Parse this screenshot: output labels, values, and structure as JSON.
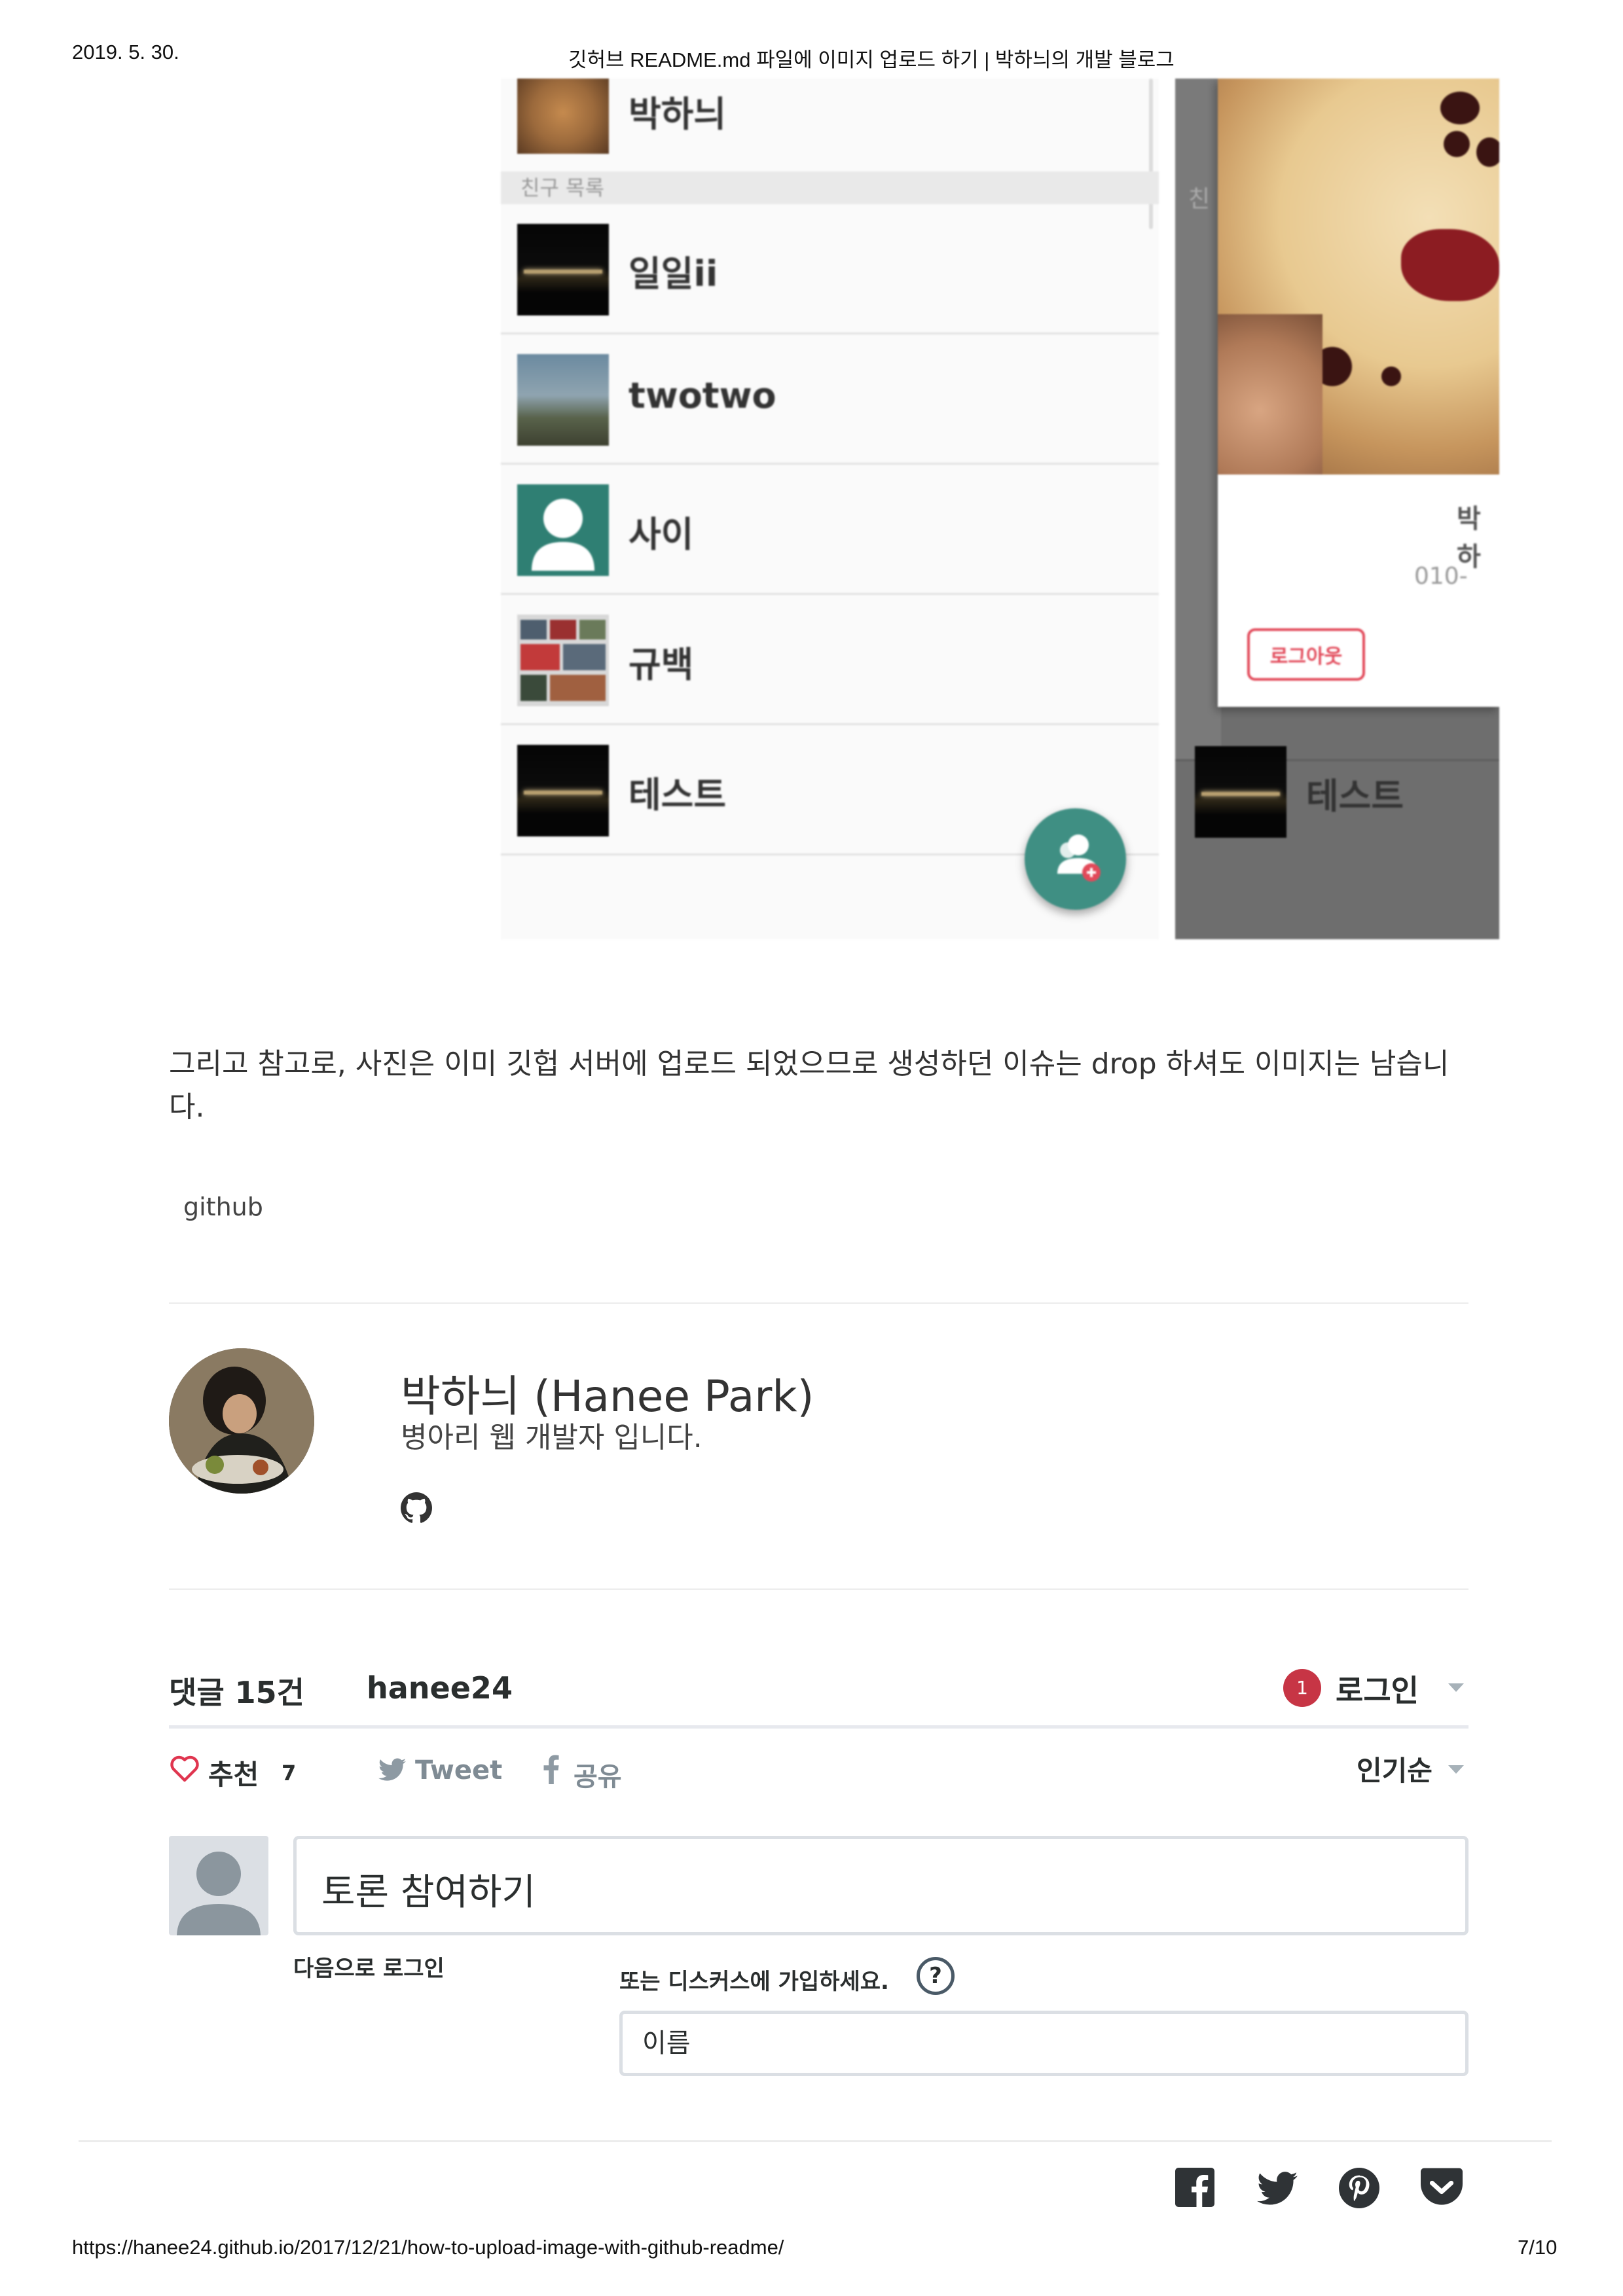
{
  "print_header": {
    "date": "2019. 5. 30.",
    "title": "깃허브 README.md 파일에 이미지 업로드 하기 | 박하늬의 개발 블로그"
  },
  "screenshot": {
    "my_name": "박하늬",
    "section_label": "친구 목록",
    "friends": [
      {
        "name": "일일ii",
        "thumb": "night-bridge"
      },
      {
        "name": "twotwo",
        "thumb": "landscape"
      },
      {
        "name": "사이",
        "thumb": "default-person-icon"
      },
      {
        "name": "규백",
        "thumb": "collage"
      },
      {
        "name": "테스트",
        "thumb": "night-bridge"
      }
    ],
    "right_section_label_partial": "친",
    "right_last_friend": "테스트",
    "profile_card": {
      "name_partial": "박하",
      "phone_partial": "010-",
      "logout_label": "로그아웃"
    },
    "fab_icon": "add-friend-icon"
  },
  "article": {
    "paragraph": "그리고 참고로, 사진은 이미 깃헙 서버에 업로드 되었으므로 생성하던 이슈는 drop 하셔도 이미지는 남습니다.",
    "tag": "github"
  },
  "author": {
    "name": "박하늬 (Hanee Park)",
    "description": "병아리 웹 개발자 입니다.",
    "social_icon": "github-icon"
  },
  "disqus": {
    "comment_count": "댓글 15건",
    "site": "hanee24",
    "notification_count": "1",
    "login_label": "로그인",
    "recommend_label": "추천",
    "recommend_count": "7",
    "tweet_label": "Tweet",
    "share_label": "공유",
    "sort_label": "인기순",
    "comment_placeholder": "토론 참여하기",
    "login_with_label": "다음으로 로그인",
    "signup_label": "또는 디스커스에 가입하세요.",
    "help_icon": "?",
    "name_placeholder": "이름"
  },
  "share_icons": [
    "facebook-icon",
    "twitter-icon",
    "pinterest-icon",
    "pocket-icon"
  ],
  "print_footer": {
    "url": "https://hanee24.github.io/2017/12/21/how-to-upload-image-with-github-readme/",
    "page": "7/10"
  },
  "colors": {
    "teal": "#3f8f83",
    "logout_red": "#e24a5a",
    "heart_red": "#e0354f",
    "badge_red": "#c73545"
  }
}
